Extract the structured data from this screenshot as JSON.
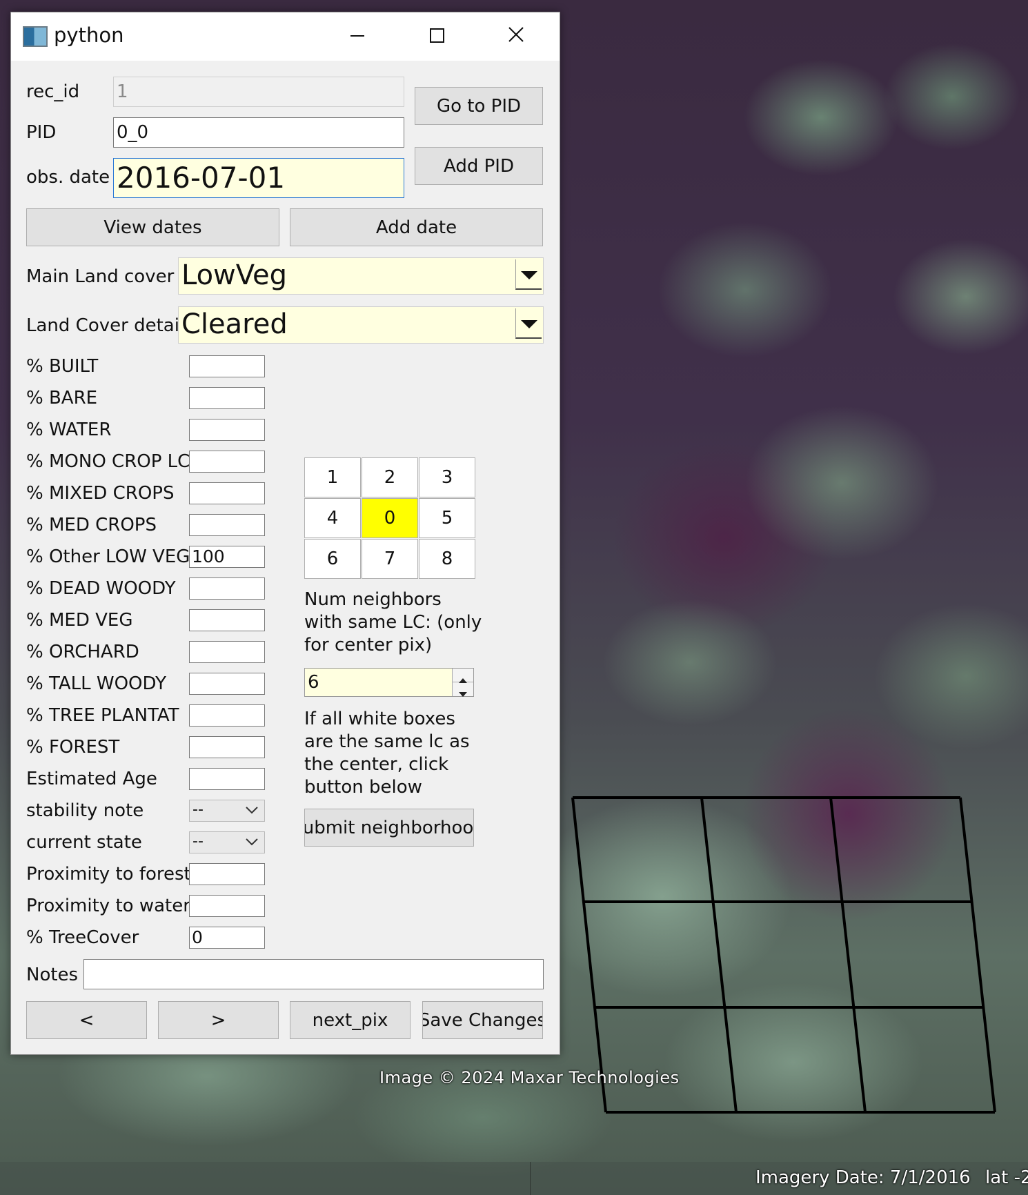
{
  "window": {
    "title": "python",
    "controls": {
      "minimize": "minimize-icon",
      "maximize": "maximize-icon",
      "close": "close-icon"
    }
  },
  "form": {
    "rec_id": {
      "label": "rec_id",
      "value": "1"
    },
    "pid": {
      "label": "PID",
      "value": "0_0"
    },
    "obs_date": {
      "label": "obs. date",
      "value": "2016-07-01"
    },
    "buttons": {
      "go_to_pid": "Go to PID",
      "add_pid": "Add PID",
      "view_dates": "View dates",
      "add_date": "Add date"
    },
    "main_land_cover": {
      "label": "Main Land cover",
      "value": "LowVeg"
    },
    "land_cover_detail": {
      "label": "Land Cover detail",
      "value": "Cleared"
    },
    "percentages": [
      {
        "label": "% BUILT",
        "value": ""
      },
      {
        "label": "% BARE",
        "value": ""
      },
      {
        "label": "% WATER",
        "value": ""
      },
      {
        "label": "% MONO CROP LC",
        "value": ""
      },
      {
        "label": "% MIXED CROPS",
        "value": ""
      },
      {
        "label": "% MED CROPS",
        "value": ""
      },
      {
        "label": "% Other LOW VEG",
        "value": "100"
      },
      {
        "label": "% DEAD WOODY",
        "value": ""
      },
      {
        "label": "% MED VEG",
        "value": ""
      },
      {
        "label": "% ORCHARD",
        "value": ""
      },
      {
        "label": "% TALL WOODY",
        "value": ""
      },
      {
        "label": "% TREE PLANTATI",
        "value": ""
      },
      {
        "label": "% FOREST",
        "value": ""
      },
      {
        "label": "Estimated Age",
        "value": ""
      }
    ],
    "stability_note": {
      "label": "stability note",
      "value": "--"
    },
    "current_state": {
      "label": "current state",
      "value": "--"
    },
    "proximity_forest": {
      "label": "Proximity to forest",
      "value": ""
    },
    "proximity_water": {
      "label": "Proximity to water",
      "value": ""
    },
    "tree_cover": {
      "label": "% TreeCover",
      "value": "0"
    },
    "notes": {
      "label": "Notes",
      "value": ""
    },
    "nav": {
      "prev": "<",
      "next": ">",
      "next_pix": "next_pix",
      "save": "Save Changes"
    }
  },
  "neighborhood": {
    "grid": [
      "1",
      "2",
      "3",
      "4",
      "0",
      "5",
      "6",
      "7",
      "8"
    ],
    "highlight_color": "#ffff00",
    "neighbors_label": "Num neighbors with same LC: (only for center pix)",
    "neighbors_value": "6",
    "instruction": "If all white boxes are the same lc as the center, click button below",
    "submit_button": "submit neighborhood"
  },
  "map": {
    "attribution": "Image © 2024 Maxar Technologies",
    "imagery_date": "Imagery Date: 7/1/2016",
    "lat_label": "lat  -2"
  }
}
